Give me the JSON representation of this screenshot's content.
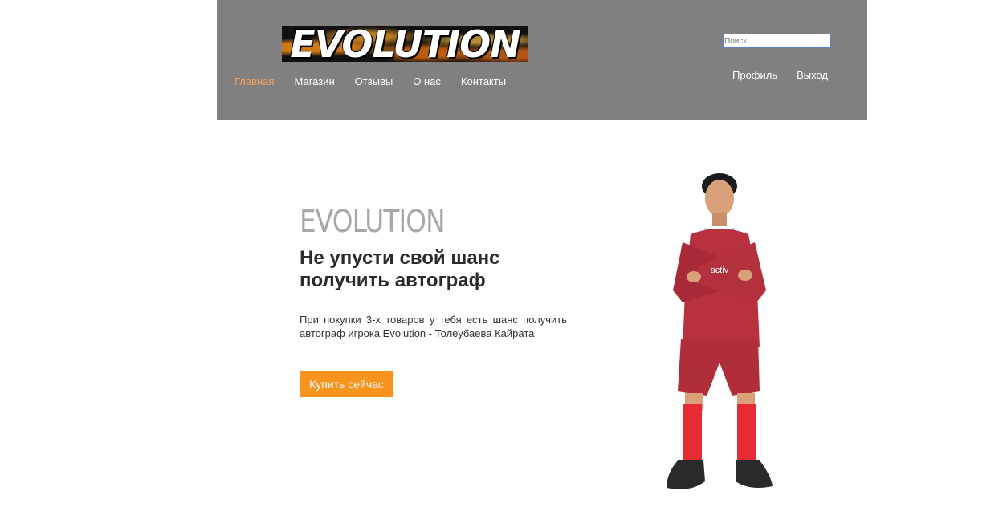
{
  "header": {
    "logo_text": "EVOLUTION",
    "nav": [
      {
        "label": "Главная",
        "active": true
      },
      {
        "label": "Магазин",
        "active": false
      },
      {
        "label": "Отзывы",
        "active": false
      },
      {
        "label": "О нас",
        "active": false
      },
      {
        "label": "Контакты",
        "active": false
      }
    ],
    "search": {
      "placeholder": "Поиск..."
    },
    "user_links": [
      "Профиль",
      "Выход"
    ]
  },
  "hero": {
    "brand": "EVOLUTION",
    "headline_line1": "Не упусти свой шанс",
    "headline_line2": "получить автограф",
    "description": "При покупки 3-х товаров у тебя есть шанс получить автограф игрока Evolution - Толеубаева Кайрата",
    "button_label": "Купить сейчас",
    "player_jersey_text": "activ"
  },
  "colors": {
    "header_bg": "#808080",
    "nav_active": "#f6a15b",
    "button_bg": "#f7941d",
    "brand_gray": "#a7a7a7",
    "jersey_red": "#b8313f"
  }
}
